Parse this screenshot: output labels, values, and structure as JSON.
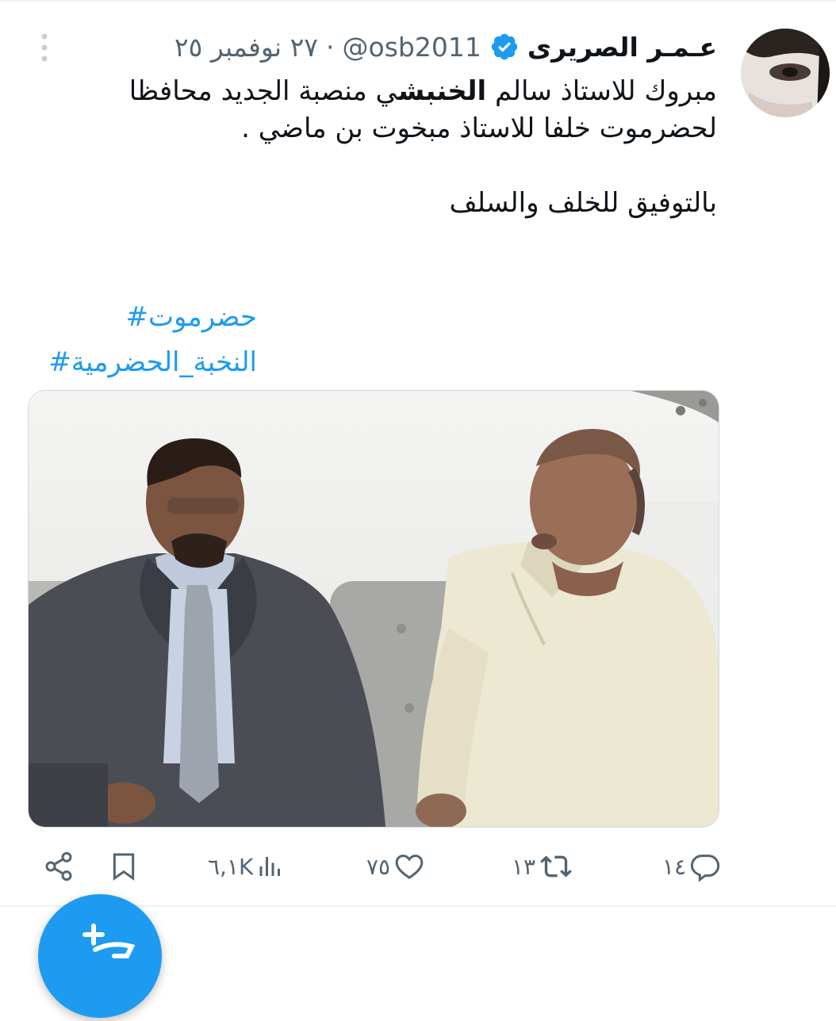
{
  "tweet": {
    "author_name": "عـمـر الصريرى",
    "handle": "@osb2011",
    "separator": "·",
    "date": "٢٧ نوفمبر ٢٥",
    "text_line1_a": "مبروك للاستاذ سالم ",
    "text_line1_bold": "الخنبش",
    "text_line1_b": "ي منصبة الجديد محافظا",
    "text_line2": "لحضرموت خلفا للاستاذ مبخوت بن ماضي .",
    "text_line3": "بالتوفيق للخلف والسلف",
    "hashtags": [
      "حضرموت#",
      "النخبة_الحضرمية#"
    ]
  },
  "actions": {
    "replies": "١٤",
    "retweets": "١٣",
    "likes": "٧٥",
    "views": "٦,١K"
  },
  "icons": [
    "more-vertical-icon",
    "verified-badge-icon",
    "reply-icon",
    "retweet-icon",
    "like-icon",
    "views-icon",
    "bookmark-icon",
    "share-icon",
    "compose-icon"
  ],
  "colors": {
    "accent": "#1d9bf0",
    "muted": "#536471",
    "text": "#0f1419"
  }
}
